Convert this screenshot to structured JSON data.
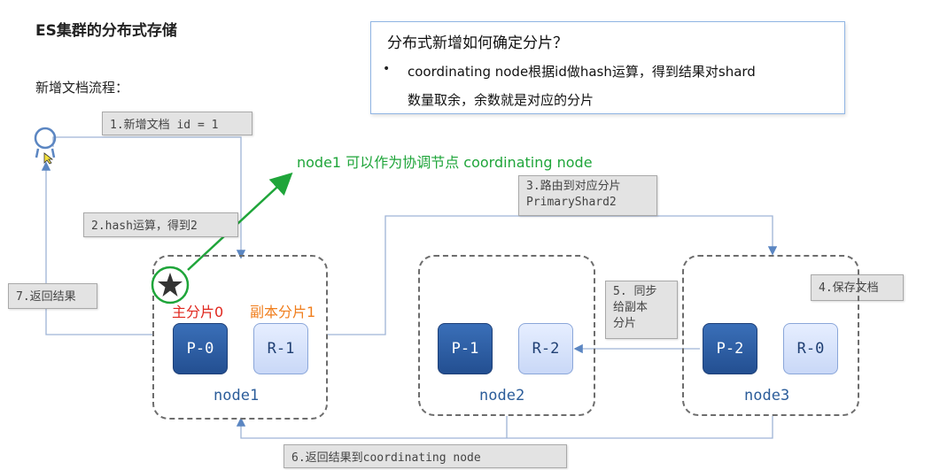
{
  "title": "ES集群的分布式存储",
  "subtitle": "新增文档流程：",
  "info": {
    "title": "分布式新增如何确定分片？",
    "bullet": "•",
    "line1": "coordinating node根据id做hash运算，得到结果对shard",
    "line2": "数量取余，余数就是对应的分片"
  },
  "steps": {
    "s1": "1.新增文档 id = 1",
    "s2": "2.hash运算，得到2",
    "s3_line1": "3.路由到对应分片",
    "s3_line2": "PrimaryShard2",
    "s4": "4.保存文档",
    "s5_line1": "5. 同步",
    "s5_line2": "给副本",
    "s5_line3": "分片",
    "s6": "6.返回结果到coordinating node",
    "s7": "7.返回结果"
  },
  "annotation": "node1 可以作为协调节点  coordinating node",
  "node1": {
    "name": "node1",
    "primary": "P-0",
    "replica": "R-1",
    "primary_label": "主分片0",
    "replica_label": "副本分片1"
  },
  "node2": {
    "name": "node2",
    "primary": "P-1",
    "replica": "R-2"
  },
  "node3": {
    "name": "node3",
    "primary": "P-2",
    "replica": "R-0"
  },
  "colors": {
    "green": "#1fa53a",
    "red": "#e0271e",
    "orange": "#f07e1d",
    "primary": "#234f91",
    "node_text": "#2c5d9a"
  },
  "icons": {
    "user": "user-icon",
    "star": "star-icon",
    "cursor": "cursor-icon"
  }
}
